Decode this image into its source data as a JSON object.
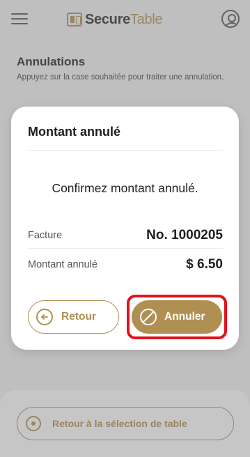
{
  "app": {
    "brand_primary": "Secure",
    "brand_secondary": "Table"
  },
  "background_page": {
    "heading": "Annulations",
    "subtitle": "Appuyez sur la case souhaitée pour traiter une annulation.",
    "back_to_table_label": "Retour à la sélection de table"
  },
  "dialog": {
    "title": "Montant annulé",
    "message": "Confirmez montant annulé.",
    "rows": [
      {
        "label": "Facture",
        "value": "No. 1000205"
      },
      {
        "label": "Montant annulé",
        "value": "$ 6.50"
      }
    ],
    "return_label": "Retour",
    "cancel_label": "Annuler"
  },
  "icons": {
    "menu": "hamburger-menu-icon",
    "account": "account-icon",
    "brand": "securetable-logo-icon",
    "back": "arrow-left-circle-icon",
    "cancel": "prohibited-circle-icon",
    "radio": "radio-circle-icon"
  },
  "colors": {
    "accent": "#b08f52",
    "highlight": "#e0121b",
    "overlay": "rgba(120,120,120,0.42)"
  }
}
